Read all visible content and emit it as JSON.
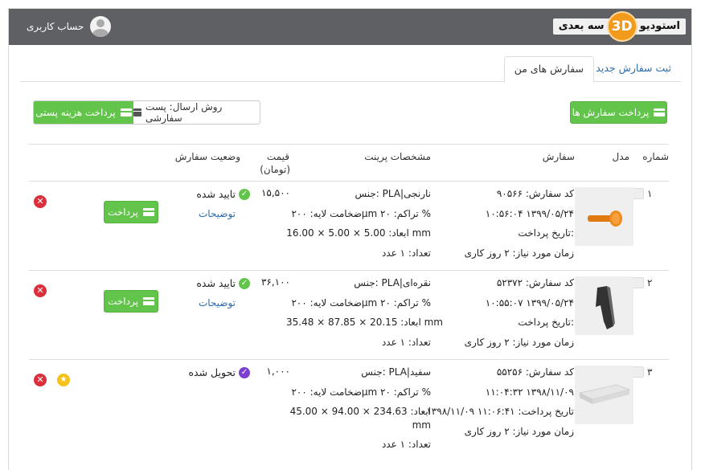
{
  "header": {
    "logo_word_studio": "استودیو",
    "logo_3d": "3D",
    "logo_word_3d": "سه بعدی",
    "user_label": "حساب کاربری"
  },
  "tabs": [
    {
      "label": "ثبت سفارش جدید",
      "active": false
    },
    {
      "label": "سفارش های من",
      "active": true
    }
  ],
  "actions": {
    "pay_orders": "پرداخت سفارش ها",
    "shipping_method": "روش ارسال: پست سفارشی",
    "pay_postage": "پرداخت هزینه پستی"
  },
  "table": {
    "headers": {
      "number": "شماره",
      "model": "مدل",
      "order": "سفارش",
      "print_specs": "مشخصات پرینت",
      "price_line1": "قیمت",
      "price_line2": "(تومان)",
      "status": "وضعیت سفارش"
    },
    "rows": [
      {
        "number": "۱",
        "order_code": "کد سفارش: ۹۰۵۶۶",
        "order_date": "۱۰:۵۶:۰۴ ۱۳۹۹/۰۵/۲۴",
        "pay_date": "تاریخ پرداخت:",
        "lead_time": "زمان مورد نیاز: ۲ روز کاری",
        "material": "جنس: PLA|نارنجی",
        "layer": "ضخامت لایه: ۲۰۰μm   تراکم: ۲۰ %",
        "dims": "ابعاد: 5.00 × 5.00 × 16.00 mm",
        "qty": "تعداد: ۱ عدد",
        "price": "۱۵,۵۰۰",
        "status": "تایید شده",
        "details_link": "توضیحات",
        "pay_label": "پرداخت"
      },
      {
        "number": "۲",
        "order_code": "کد سفارش: ۵۲۳۷۲",
        "order_date": "۱۰:۵۵:۰۷ ۱۳۹۹/۰۵/۲۴",
        "pay_date": "تاریخ پرداخت:",
        "lead_time": "زمان مورد نیاز: ۲ روز کاری",
        "material": "جنس: PLA|نقره‌ای",
        "layer": "ضخامت لایه: ۲۰۰μm   تراکم: ۲۰ %",
        "dims": "ابعاد: 20.15 × 87.85 × 35.48 mm",
        "qty": "تعداد: ۱ عدد",
        "price": "۳۶,۱۰۰",
        "status": "تایید شده",
        "details_link": "توضیحات",
        "pay_label": "پرداخت"
      },
      {
        "number": "۳",
        "order_code": "کد سفارش: ۵۵۲۵۶",
        "order_date": "۱۱:۰۴:۳۲ ۱۳۹۸/۱۱/۰۹",
        "pay_date": "تاریخ پرداخت: ۱۱:۰۶:۴۱ ۱۳۹۸/۱۱/۰۹",
        "lead_time": "زمان مورد نیاز: ۲ روز کاری",
        "material": "جنس: PLA|سفید",
        "layer": "ضخامت لایه: ۲۰۰μm   تراکم: ۲۰ %",
        "dims": "ابعاد: 234.63 × 94.00 × 45.00",
        "dims_unit": "mm",
        "qty": "تعداد: ۱ عدد",
        "price": "۱,۰۰۰",
        "status": "تحویل شده"
      }
    ]
  },
  "colors": {
    "header_bg": "#5f6063",
    "accent_green": "#62c44a",
    "link_blue": "#2a6cb0",
    "delete_red": "#dc2f3c",
    "delivered_purple": "#7d3fd0",
    "star_yellow": "#f4c21a",
    "logo_orange": "#f29a1b"
  }
}
